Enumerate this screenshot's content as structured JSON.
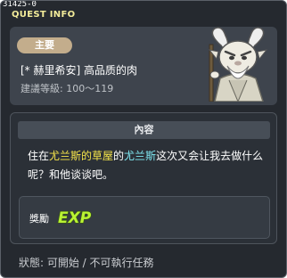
{
  "window": {
    "id_text": "31425-0",
    "title": "QUEST INFO"
  },
  "quest": {
    "type_badge": "主要",
    "title": "[* 赫里希安] 高品质的肉",
    "level": "建議等級: 100～119"
  },
  "npc": {
    "portrait_icon": "old-goat-sage-npc-portrait"
  },
  "content": {
    "header": "內容",
    "text_parts": {
      "p1": "住在",
      "p2": "尤兰斯的草屋",
      "p3": "的",
      "p4": "尤兰斯",
      "p5": "这次又会让我去做什么呢？和他谈谈吧。"
    }
  },
  "reward": {
    "label": "獎勵",
    "exp_text": "EXP",
    "exp_icon": "exp-icon"
  },
  "status": {
    "text": "狀態:  可開始 / 不可執行任務"
  },
  "colors": {
    "window_bg": "#25292f",
    "card_bg": "#3e444d",
    "badge_bg": "#c3ad8c",
    "title_yellow": "#f3ec9a",
    "highlight_yellow": "#f6e54a",
    "highlight_cyan": "#7fe7f1",
    "exp_green": "#b9f233"
  }
}
